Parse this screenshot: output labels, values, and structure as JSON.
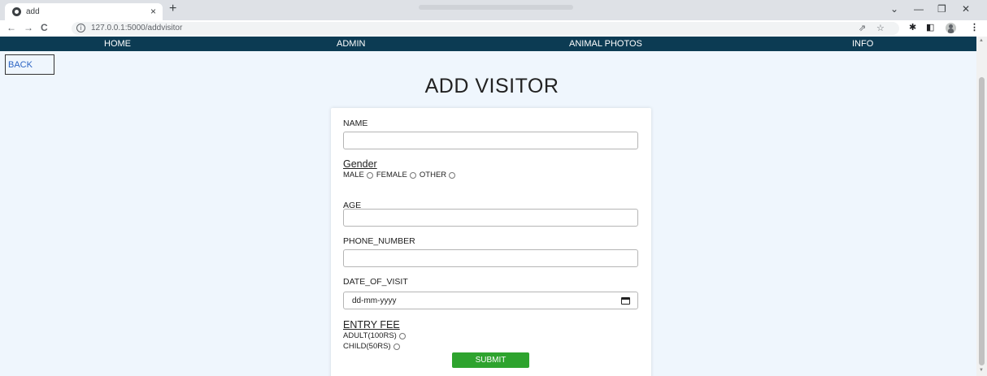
{
  "browser": {
    "tab_title": "add",
    "tab_close": "×",
    "new_tab": "+",
    "url": "127.0.0.1:5000/addvisitor",
    "window_controls": {
      "dropdown": "⌄",
      "minimize": "—",
      "restore": "❐",
      "close": "✕"
    },
    "nav": {
      "back": "←",
      "forward": "→",
      "reload": "C"
    },
    "icons": [
      "info-icon",
      "share-icon",
      "star-icon",
      "extension-icon",
      "sidepanel-icon",
      "profile-icon",
      "menu-icon"
    ]
  },
  "navbar": {
    "items": [
      {
        "label": "HOME"
      },
      {
        "label": "ADMIN"
      },
      {
        "label": "ANIMAL PHOTOS"
      },
      {
        "label": "INFO"
      }
    ]
  },
  "back_label": "BACK",
  "page_title": "ADD VISITOR",
  "form": {
    "name_label": "NAME",
    "name_value": "",
    "gender_title": "Gender",
    "gender_options": [
      "MALE",
      "FEMALE",
      "OTHER"
    ],
    "age_label": "AGE",
    "age_value": "",
    "phone_label": "PHONE_NUMBER",
    "phone_value": "",
    "date_label": "DATE_OF_VISIT",
    "date_placeholder": "dd-mm-yyyy",
    "fee_title": "ENTRY FEE",
    "fee_options": [
      "ADULT(100RS)",
      "CHILD(50RS)"
    ],
    "submit_label": "SUBMIT"
  },
  "colors": {
    "navbar": "#0c3b53",
    "page_bg": "#eff6fd",
    "submit": "#2ea32e",
    "back_text": "#2b64c4"
  }
}
